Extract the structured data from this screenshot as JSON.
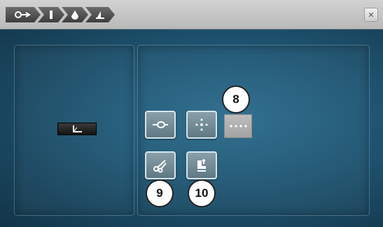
{
  "breadcrumb": {
    "items": [
      {
        "icon": "thread-cutter-icon"
      },
      {
        "icon": "presser-foot-icon"
      },
      {
        "icon": "bobbin-icon"
      },
      {
        "icon": "stitch-width-icon"
      }
    ]
  },
  "close_button": {
    "icon": "close-icon"
  },
  "stitch_indicator": {
    "icon": "stitch-length-icon"
  },
  "function_buttons": [
    {
      "name": "securing-stitch-button",
      "icon": "securing-stitch-icon"
    },
    {
      "name": "needle-position-button",
      "icon": "needle-position-icon"
    },
    {
      "name": "thread-cutter-button",
      "icon": "scissors-icon"
    },
    {
      "name": "presser-foot-lift-button",
      "icon": "presser-foot-lift-icon"
    }
  ],
  "dotted_button": {
    "icon": "stitch-dots-icon"
  },
  "callouts": {
    "c8": "8",
    "c9": "9",
    "c10": "10"
  }
}
